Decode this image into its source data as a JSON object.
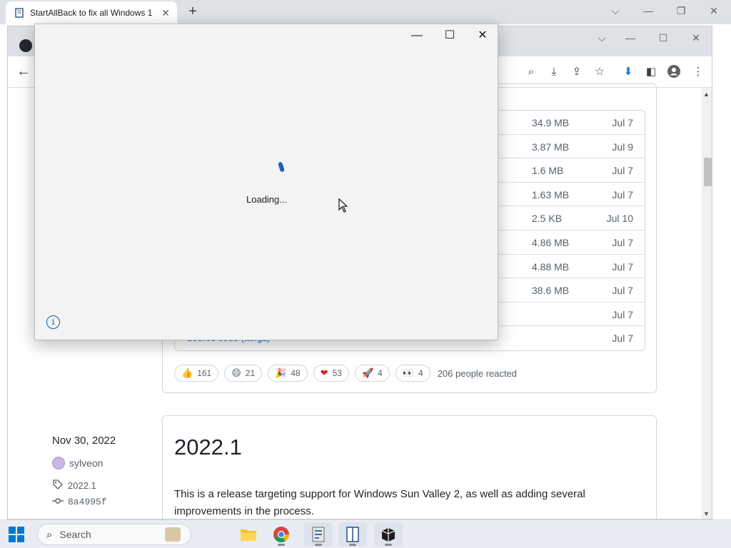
{
  "outer_browser": {
    "tab_title": "StartAllBack to fix all Windows 1",
    "new_tab_symbol": "+"
  },
  "dialog": {
    "loading_text": "Loading..."
  },
  "assets": [
    {
      "size": "34.9 MB",
      "date": "Jul 7"
    },
    {
      "size": "3.87 MB",
      "date": "Jul 9"
    },
    {
      "size": "1.6 MB",
      "date": "Jul 7"
    },
    {
      "size": "1.63 MB",
      "date": "Jul 7"
    },
    {
      "size": "2.5 KB",
      "date": "Jul 10"
    },
    {
      "size": "4.86 MB",
      "date": "Jul 7"
    },
    {
      "size": "4.88 MB",
      "date": "Jul 7"
    },
    {
      "size": "38.6 MB",
      "date": "Jul 7"
    },
    {
      "size": "",
      "date": "Jul 7"
    },
    {
      "size": "",
      "date": "Jul 7",
      "label": "Source code (tar.gz)"
    }
  ],
  "reactions": [
    {
      "emoji": "👍",
      "count": "161"
    },
    {
      "emoji": "😄",
      "count": "21"
    },
    {
      "emoji": "🎉",
      "count": "48"
    },
    {
      "emoji": "❤",
      "count": "53"
    },
    {
      "emoji": "🚀",
      "count": "4"
    },
    {
      "emoji": "👀",
      "count": "4"
    }
  ],
  "reactions_summary": "206 people reacted",
  "release": {
    "date": "Nov 30, 2022",
    "author": "sylveon",
    "tag": "2022.1",
    "commit": "8a4995f",
    "title": "2022.1",
    "body": "This is a release targeting support for Windows Sun Valley 2, as well as adding several improvements in the process."
  },
  "taskbar": {
    "search_placeholder": "Search"
  },
  "colors": {
    "accent": "#0078d4",
    "spinner": "#1765b8",
    "link": "#0969da"
  }
}
